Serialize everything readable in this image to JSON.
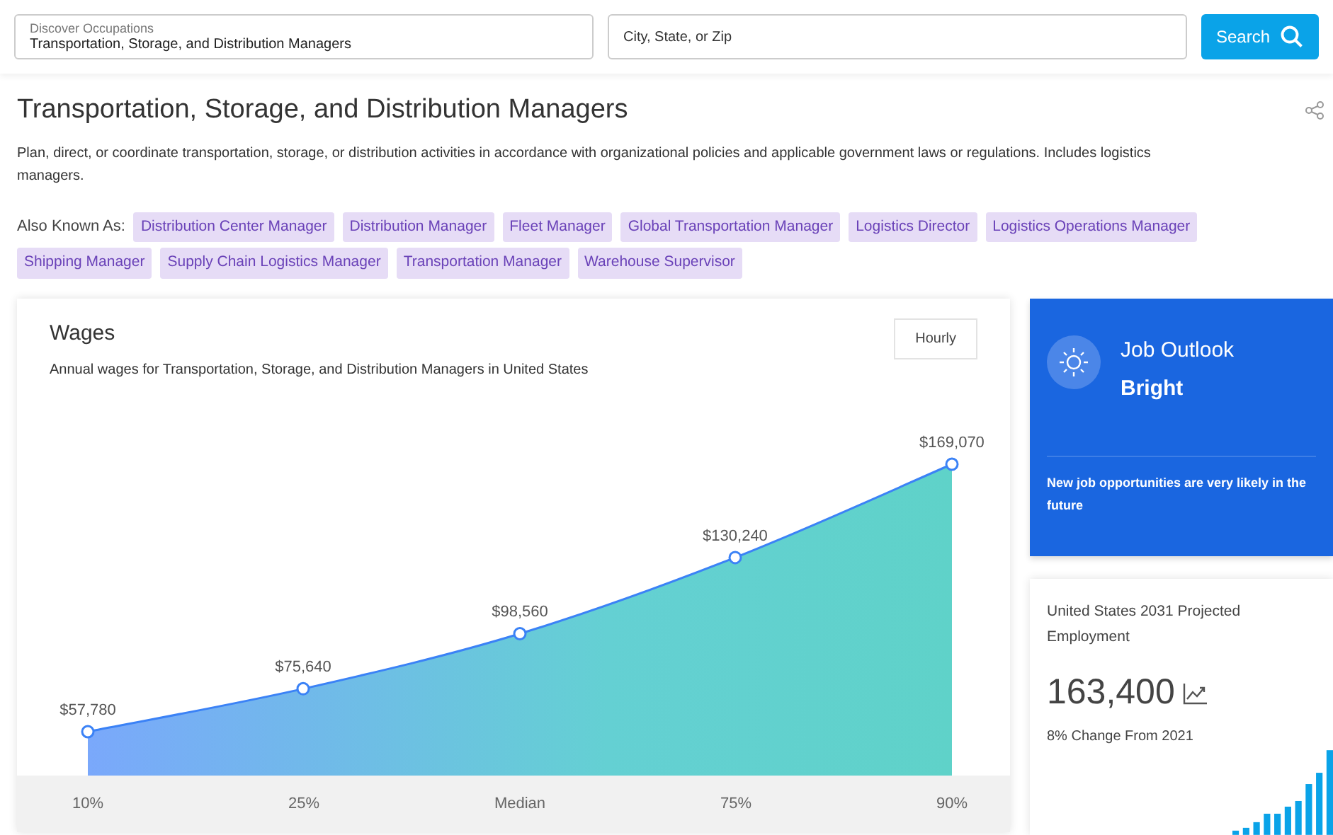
{
  "search": {
    "occupation_label": "Discover Occupations",
    "occupation_value": "Transportation, Storage, and Distribution Managers",
    "location_placeholder": "City, State, or Zip",
    "button": "Search"
  },
  "title": "Transportation, Storage, and Distribution Managers",
  "description": "Plan, direct, or coordinate transportation, storage, or distribution activities in accordance with organizational policies and applicable government laws or regulations. Includes logistics managers.",
  "also_known_as": {
    "label": "Also Known As:",
    "tags": [
      "Distribution Center Manager",
      "Distribution Manager",
      "Fleet Manager",
      "Global Transportation Manager",
      "Logistics Director",
      "Logistics Operations Manager",
      "Shipping Manager",
      "Supply Chain Logistics Manager",
      "Transportation Manager",
      "Warehouse Supervisor"
    ]
  },
  "wages": {
    "title": "Wages",
    "subtitle": "Annual wages for Transportation, Storage, and Distribution Managers in United States",
    "toggle": "Hourly",
    "chart_data": {
      "type": "area",
      "categories": [
        "10%",
        "25%",
        "Median",
        "75%",
        "90%"
      ],
      "series": [
        {
          "color": "#3b82f6",
          "values": [
            57780,
            75640,
            98560,
            130240,
            169070
          ],
          "value_labels": [
            "$57,780",
            "$75,640",
            "$98,560",
            "$130,240",
            "$169,070"
          ]
        }
      ]
    }
  },
  "outlook": {
    "title": "Job Outlook",
    "rating": "Bright",
    "note": "New job opportunities are very likely in the future"
  },
  "projection": {
    "title": "United States 2031 Projected Employment",
    "value": "163,400",
    "change": "8% Change From 2021"
  }
}
